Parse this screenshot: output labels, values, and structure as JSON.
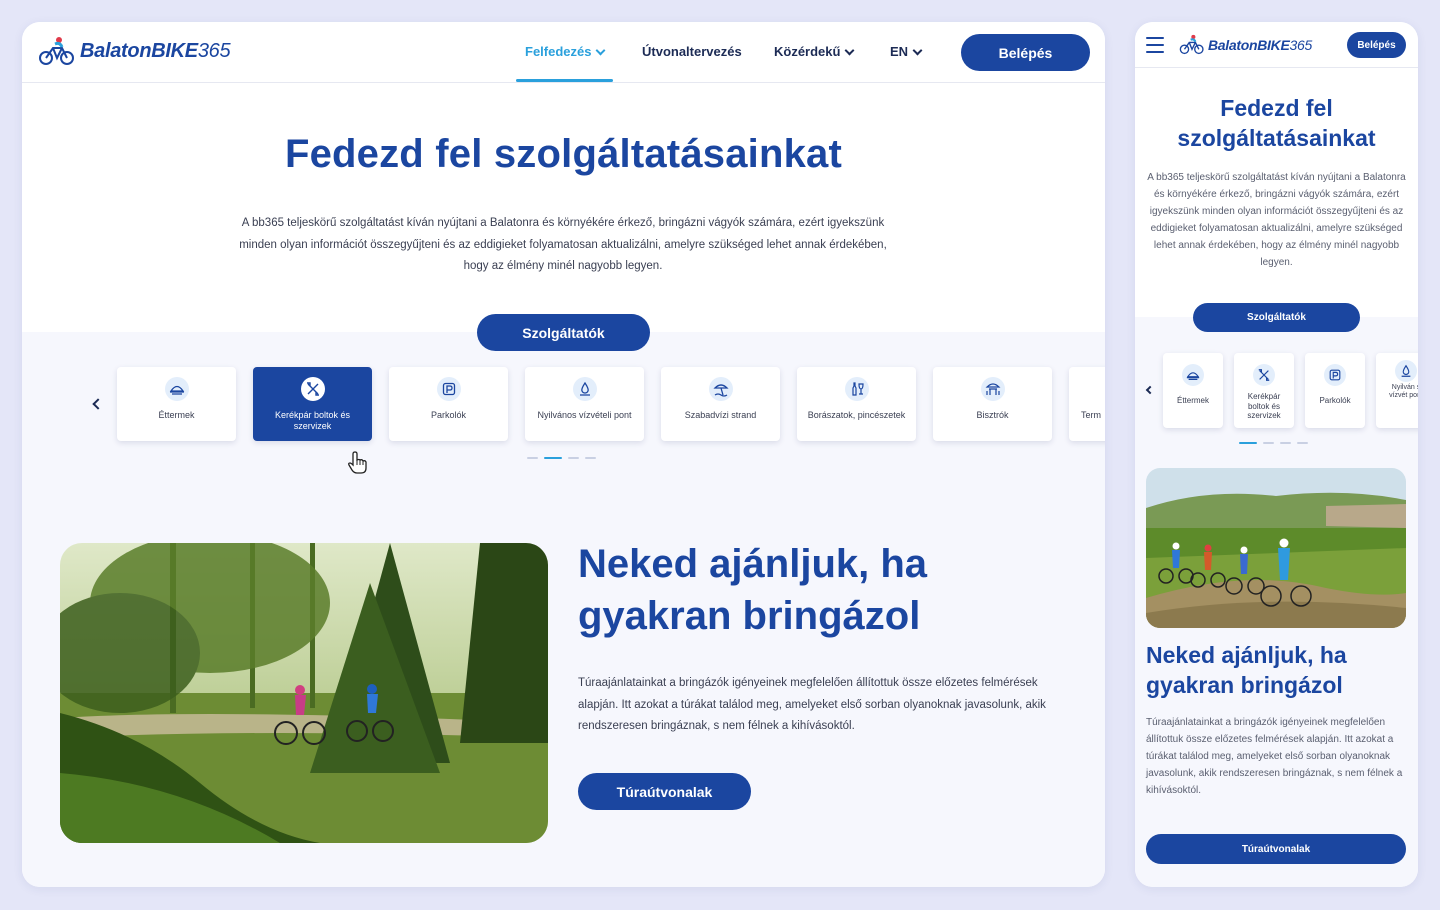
{
  "brand": {
    "name_bold": "BalatonBIKE",
    "name_suffix": "365",
    "primary_color": "#1b46a0",
    "accent_color": "#2aa0dc"
  },
  "nav": {
    "items": [
      {
        "label": "Felfedezés",
        "dropdown": true,
        "active": true
      },
      {
        "label": "Útvonaltervezés",
        "dropdown": false,
        "active": false
      },
      {
        "label": "Közérdekű",
        "dropdown": true,
        "active": false
      },
      {
        "label": "EN",
        "dropdown": true,
        "active": false
      }
    ],
    "login_label": "Belépés"
  },
  "hero": {
    "title": "Fedezd fel szolgáltatásainkat",
    "description": "A bb365 teljeskörű szolgáltatást kíván nyújtani a Balatonra és környékére érkező, bringázni vágyók számára, ezért igyekszünk minden olyan információt összegyűjteni és az eddigieket folyamatosan aktualizálni, amelyre szükséged lehet annak érdekében, hogy az élmény minél nagyobb legyen.",
    "services_button": "Szolgáltatók"
  },
  "services": {
    "categories": [
      {
        "label": "Éttermek",
        "icon": "restaurant-icon"
      },
      {
        "label": "Kerékpár boltok és szervizek",
        "icon": "bike-service-icon",
        "selected": true
      },
      {
        "label": "Parkolók",
        "icon": "parking-icon"
      },
      {
        "label": "Nyilvános vízvételi pont",
        "icon": "water-point-icon"
      },
      {
        "label": "Szabadvízi strand",
        "icon": "beach-icon"
      },
      {
        "label": "Borászatok, pincészetek",
        "icon": "winery-icon"
      },
      {
        "label": "Bisztrók",
        "icon": "bistro-icon"
      },
      {
        "label": "Term",
        "icon": "generic-icon"
      }
    ],
    "mobile_labels": [
      "Éttermek",
      "Kerékpár boltok és szervizek",
      "Parkolók",
      "Nyilván s vízvét pont"
    ],
    "page_dots": 4,
    "active_dot": 1
  },
  "feature": {
    "title": "Neked ajánljuk, ha gyakran bringázol",
    "description": "Túraajánlatainkat a bringázók igényeinek megfelelően állítottuk össze előzetes felmérések alapján. Itt azokat a túrákat találod meg, amelyeket első sorban olyanoknak javasolunk, akik rendszeresen bringáznak, s nem félnek a kihívásoktól.",
    "button": "Túraútvonalak"
  },
  "mobile": {
    "hero_title": "Fedezd fel szolgáltatásainkat",
    "active_dot": 0
  }
}
